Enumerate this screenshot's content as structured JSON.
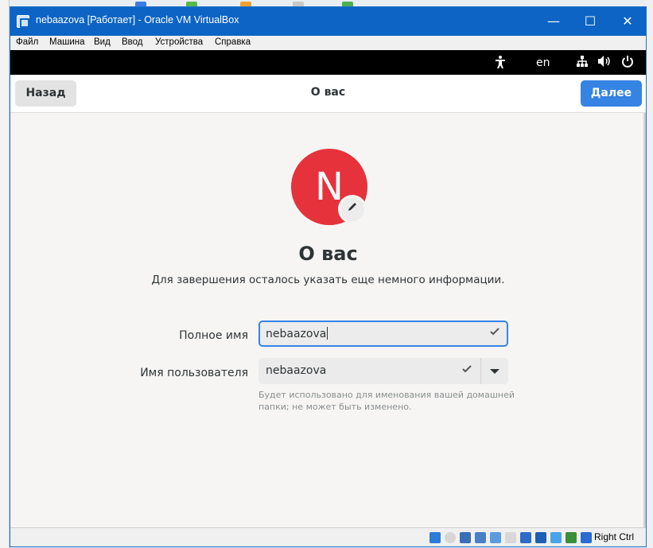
{
  "window": {
    "title": "nebaazova [Работает] - Oracle VM VirtualBox",
    "controls": {
      "minimize": "—",
      "maximize": "☐",
      "close": "✕"
    }
  },
  "menubar": [
    "Файл",
    "Машина",
    "Вид",
    "Ввод",
    "Устройства",
    "Справка"
  ],
  "gnome_topbar": {
    "accessibility_icon": "accessibility-icon",
    "language": "en",
    "network_icon": "network-icon",
    "volume_icon": "volume-icon",
    "power_icon": "power-icon"
  },
  "headerbar": {
    "back_label": "Назад",
    "title": "О вас",
    "next_label": "Далее"
  },
  "avatar": {
    "initial": "N",
    "color": "#e5323b",
    "edit_icon": "pencil-icon"
  },
  "page": {
    "heading": "О вас",
    "subheading": "Для завершения осталось указать еще немного информации."
  },
  "form": {
    "full_name_label": "Полное имя",
    "full_name_value": "nebaazova",
    "username_label": "Имя пользователя",
    "username_value": "nebaazova",
    "username_hint": "Будет использовано для именования вашей домашней папки; не может быть изменено."
  },
  "statusbar": {
    "host_key": "Right Ctrl"
  },
  "colors": {
    "accent": "#3584e4",
    "titlebar": "#0d64c4"
  }
}
